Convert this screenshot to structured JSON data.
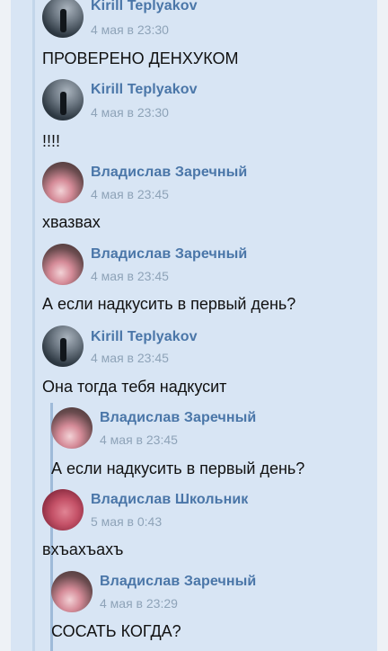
{
  "messages": [
    {
      "author": "Kirill Teplyakov",
      "time": "4 мая в 23:30",
      "text": "ПРОВЕРЕНО ДЕНХУКОМ"
    },
    {
      "author": "Kirill Teplyakov",
      "time": "4 мая в 23:30",
      "text": "!!!!"
    },
    {
      "author": "Владислав Заречный",
      "time": "4 мая в 23:45",
      "text": "хвазвах"
    },
    {
      "author": "Владислав Заречный",
      "time": "4 мая в 23:45",
      "text": "А если надкусить в первый день?"
    },
    {
      "author": "Kirill Teplyakov",
      "time": "4 мая в 23:45",
      "text": "Она тогда тебя надкусит"
    },
    {
      "author": "Владислав Заречный",
      "time": "4 мая в 23:45",
      "text": "А если надкусить в первый день?"
    },
    {
      "author": "Владислав Школьник",
      "time": "5 мая в 0:43",
      "text": "вхъахъахъ"
    },
    {
      "author": "Владислав Заречный",
      "time": "4 мая в 23:29",
      "text": "СОСАТЬ КОГДА?"
    }
  ],
  "icons": {
    "avatar_kirill": "avatar-icon",
    "avatar_zarechny": "avatar-icon",
    "avatar_shkolnik": "avatar-icon"
  }
}
